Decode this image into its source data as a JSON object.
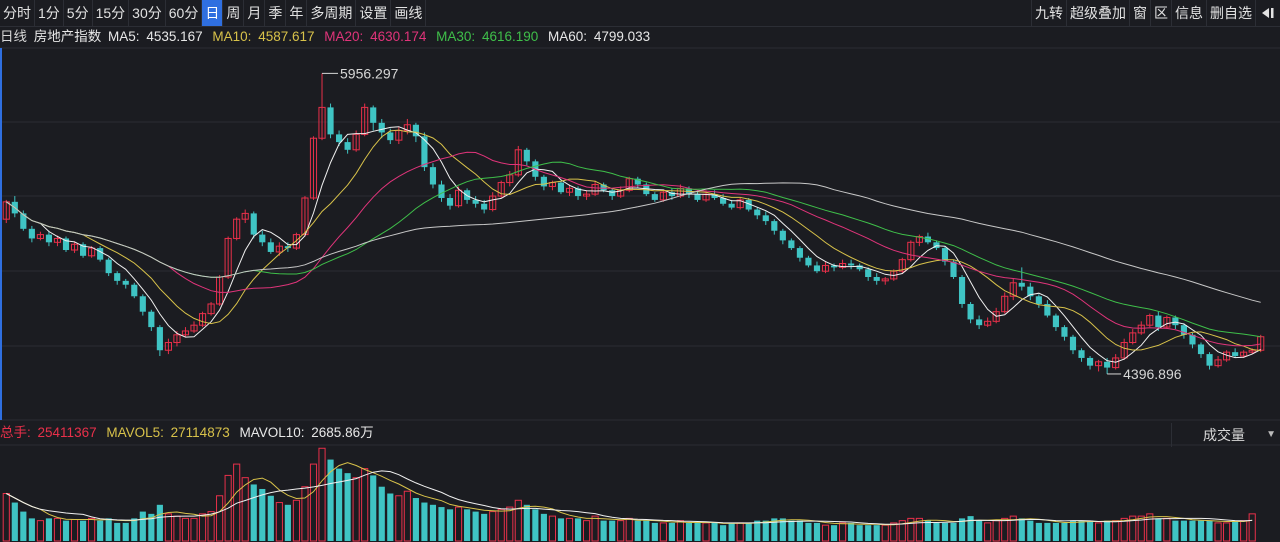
{
  "toolbar": {
    "periods": [
      "分时",
      "1分",
      "5分",
      "15分",
      "30分",
      "60分",
      "日",
      "周",
      "月",
      "季",
      "年",
      "多周期",
      "设置",
      "画线"
    ],
    "active_period": "日",
    "right_buttons": [
      "九转",
      "超级叠加",
      "窗",
      "区",
      "信息",
      "删自选"
    ],
    "exit_icon": "exit-arrow-icon"
  },
  "info": {
    "period": "日线",
    "name": "房地产指数",
    "ma5": {
      "label": "MA5:",
      "value": "4535.167",
      "color": "#e8e8e8"
    },
    "ma10": {
      "label": "MA10:",
      "value": "4587.617",
      "color": "#d8c24a"
    },
    "ma20": {
      "label": "MA20:",
      "value": "4630.174",
      "color": "#e0347a"
    },
    "ma30": {
      "label": "MA30:",
      "value": "4616.190",
      "color": "#3fbf4a"
    },
    "ma60": {
      "label": "MA60:",
      "value": "4799.033",
      "color": "#e8e8e8"
    }
  },
  "volume": {
    "total_label": "总手:",
    "total_value": "25411367",
    "mavol5_label": "MAVOL5:",
    "mavol5_value": "27114873",
    "mavol10_label": "MAVOL10:",
    "mavol10_value": "2685.86万",
    "selector": "成交量"
  },
  "chart_data": {
    "type": "candlestick",
    "high_label": "5956.297",
    "low_label": "4396.896",
    "high": 5956.297,
    "low": 4396.896,
    "colors": {
      "up": "#e8304a",
      "down": "#3fc4c4",
      "ma5": "#f0f0f0",
      "ma10": "#d8c24a",
      "ma20": "#e0347a",
      "ma30": "#3fbf4a",
      "ma60": "#c8c8c8"
    },
    "candles": [
      [
        5200,
        5290,
        5180,
        5300
      ],
      [
        5290,
        5230,
        5210,
        5320
      ],
      [
        5230,
        5150,
        5140,
        5245
      ],
      [
        5150,
        5100,
        5080,
        5165
      ],
      [
        5100,
        5120,
        5090,
        5135
      ],
      [
        5120,
        5080,
        5060,
        5140
      ],
      [
        5080,
        5100,
        5060,
        5115
      ],
      [
        5100,
        5040,
        5030,
        5110
      ],
      [
        5040,
        5070,
        5025,
        5085
      ],
      [
        5070,
        5010,
        5000,
        5080
      ],
      [
        5010,
        5050,
        5000,
        5060
      ],
      [
        5050,
        4990,
        4980,
        5060
      ],
      [
        4990,
        4920,
        4905,
        5000
      ],
      [
        4920,
        4880,
        4860,
        4930
      ],
      [
        4880,
        4860,
        4840,
        4890
      ],
      [
        4860,
        4800,
        4790,
        4870
      ],
      [
        4800,
        4720,
        4700,
        4810
      ],
      [
        4720,
        4640,
        4620,
        4730
      ],
      [
        4640,
        4520,
        4490,
        4650
      ],
      [
        4520,
        4560,
        4500,
        4580
      ],
      [
        4560,
        4600,
        4540,
        4620
      ],
      [
        4600,
        4620,
        4590,
        4640
      ],
      [
        4620,
        4650,
        4610,
        4670
      ],
      [
        4650,
        4710,
        4640,
        4720
      ],
      [
        4710,
        4760,
        4700,
        4770
      ],
      [
        4760,
        4900,
        4750,
        4910
      ],
      [
        4900,
        5100,
        4890,
        5110
      ],
      [
        5100,
        5200,
        5090,
        5210
      ],
      [
        5200,
        5230,
        5180,
        5250
      ],
      [
        5230,
        5120,
        5100,
        5240
      ],
      [
        5120,
        5080,
        5060,
        5140
      ],
      [
        5080,
        5030,
        5020,
        5100
      ],
      [
        5030,
        5060,
        5010,
        5080
      ],
      [
        5060,
        5050,
        5030,
        5080
      ],
      [
        5050,
        5120,
        5040,
        5130
      ],
      [
        5120,
        5310,
        5110,
        5320
      ],
      [
        5310,
        5620,
        5300,
        5630
      ],
      [
        5620,
        5780,
        5610,
        5956.3
      ],
      [
        5780,
        5640,
        5620,
        5800
      ],
      [
        5640,
        5600,
        5580,
        5660
      ],
      [
        5600,
        5560,
        5540,
        5620
      ],
      [
        5560,
        5640,
        5550,
        5660
      ],
      [
        5640,
        5780,
        5630,
        5800
      ],
      [
        5780,
        5700,
        5660,
        5790
      ],
      [
        5700,
        5650,
        5620,
        5720
      ],
      [
        5650,
        5610,
        5590,
        5670
      ],
      [
        5610,
        5660,
        5590,
        5680
      ],
      [
        5660,
        5690,
        5640,
        5720
      ],
      [
        5690,
        5630,
        5600,
        5700
      ],
      [
        5630,
        5470,
        5450,
        5650
      ],
      [
        5470,
        5380,
        5360,
        5490
      ],
      [
        5380,
        5310,
        5290,
        5400
      ],
      [
        5310,
        5270,
        5250,
        5330
      ],
      [
        5270,
        5350,
        5260,
        5370
      ],
      [
        5350,
        5300,
        5280,
        5360
      ],
      [
        5300,
        5280,
        5260,
        5320
      ],
      [
        5280,
        5250,
        5230,
        5300
      ],
      [
        5250,
        5320,
        5240,
        5340
      ],
      [
        5320,
        5390,
        5310,
        5400
      ],
      [
        5390,
        5430,
        5370,
        5450
      ],
      [
        5430,
        5560,
        5420,
        5580
      ],
      [
        5560,
        5500,
        5480,
        5570
      ],
      [
        5500,
        5420,
        5400,
        5510
      ],
      [
        5420,
        5370,
        5350,
        5430
      ],
      [
        5370,
        5390,
        5350,
        5400
      ],
      [
        5390,
        5340,
        5330,
        5400
      ],
      [
        5340,
        5360,
        5320,
        5380
      ],
      [
        5360,
        5320,
        5300,
        5370
      ],
      [
        5320,
        5330,
        5300,
        5350
      ],
      [
        5330,
        5380,
        5320,
        5400
      ],
      [
        5380,
        5350,
        5340,
        5390
      ],
      [
        5350,
        5320,
        5300,
        5360
      ],
      [
        5320,
        5350,
        5310,
        5370
      ],
      [
        5350,
        5410,
        5340,
        5420
      ],
      [
        5410,
        5380,
        5360,
        5420
      ],
      [
        5380,
        5330,
        5320,
        5390
      ],
      [
        5330,
        5300,
        5290,
        5340
      ],
      [
        5300,
        5340,
        5290,
        5350
      ],
      [
        5340,
        5320,
        5300,
        5360
      ],
      [
        5320,
        5360,
        5310,
        5380
      ],
      [
        5360,
        5330,
        5310,
        5370
      ],
      [
        5330,
        5300,
        5290,
        5350
      ],
      [
        5300,
        5330,
        5290,
        5350
      ],
      [
        5330,
        5310,
        5300,
        5350
      ],
      [
        5310,
        5280,
        5270,
        5330
      ],
      [
        5280,
        5260,
        5250,
        5300
      ],
      [
        5260,
        5300,
        5250,
        5310
      ],
      [
        5300,
        5250,
        5240,
        5310
      ],
      [
        5250,
        5220,
        5200,
        5260
      ],
      [
        5220,
        5190,
        5170,
        5240
      ],
      [
        5190,
        5140,
        5120,
        5200
      ],
      [
        5140,
        5090,
        5070,
        5150
      ],
      [
        5090,
        5050,
        5040,
        5100
      ],
      [
        5050,
        5000,
        4980,
        5060
      ],
      [
        5000,
        4960,
        4950,
        5010
      ],
      [
        4960,
        4930,
        4920,
        4980
      ],
      [
        4930,
        4960,
        4920,
        4980
      ],
      [
        4960,
        4950,
        4930,
        4970
      ],
      [
        4950,
        4970,
        4940,
        4990
      ],
      [
        4970,
        4960,
        4940,
        4990
      ],
      [
        4960,
        4940,
        4930,
        4970
      ],
      [
        4940,
        4900,
        4880,
        4950
      ],
      [
        4900,
        4880,
        4860,
        4920
      ],
      [
        4880,
        4890,
        4860,
        4900
      ],
      [
        4890,
        4930,
        4880,
        4940
      ],
      [
        4930,
        4990,
        4920,
        5000
      ],
      [
        4990,
        5080,
        4980,
        5090
      ],
      [
        5080,
        5110,
        5060,
        5120
      ],
      [
        5110,
        5080,
        5070,
        5130
      ],
      [
        5080,
        5050,
        5040,
        5090
      ],
      [
        5050,
        4980,
        4960,
        5060
      ],
      [
        4980,
        4900,
        4890,
        4990
      ],
      [
        4900,
        4760,
        4740,
        4910
      ],
      [
        4760,
        4680,
        4660,
        4770
      ],
      [
        4680,
        4650,
        4630,
        4700
      ],
      [
        4650,
        4670,
        4640,
        4690
      ],
      [
        4670,
        4720,
        4660,
        4740
      ],
      [
        4720,
        4800,
        4710,
        4820
      ],
      [
        4800,
        4870,
        4780,
        4890
      ],
      [
        4870,
        4850,
        4830,
        4950
      ],
      [
        4850,
        4800,
        4780,
        4870
      ],
      [
        4800,
        4760,
        4740,
        4810
      ],
      [
        4760,
        4700,
        4690,
        4780
      ],
      [
        4700,
        4640,
        4620,
        4710
      ],
      [
        4640,
        4590,
        4570,
        4650
      ],
      [
        4590,
        4520,
        4500,
        4600
      ],
      [
        4520,
        4480,
        4460,
        4530
      ],
      [
        4480,
        4440,
        4420,
        4490
      ],
      [
        4440,
        4460,
        4410,
        4470
      ],
      [
        4460,
        4430,
        4396.9,
        4480
      ],
      [
        4430,
        4480,
        4420,
        4500
      ],
      [
        4480,
        4560,
        4470,
        4580
      ],
      [
        4560,
        4610,
        4550,
        4630
      ],
      [
        4610,
        4650,
        4600,
        4670
      ],
      [
        4650,
        4700,
        4640,
        4710
      ],
      [
        4700,
        4640,
        4620,
        4720
      ],
      [
        4640,
        4690,
        4630,
        4700
      ],
      [
        4690,
        4650,
        4630,
        4700
      ],
      [
        4650,
        4600,
        4580,
        4660
      ],
      [
        4600,
        4550,
        4530,
        4610
      ],
      [
        4550,
        4500,
        4480,
        4560
      ],
      [
        4500,
        4440,
        4420,
        4510
      ],
      [
        4440,
        4470,
        4430,
        4490
      ],
      [
        4470,
        4510,
        4460,
        4520
      ],
      [
        4510,
        4490,
        4480,
        4530
      ],
      [
        4490,
        4510,
        4480,
        4520
      ],
      [
        4510,
        4520,
        4500,
        4530
      ],
      [
        4520,
        4590,
        4510,
        4600
      ]
    ],
    "volumes": [
      2.1,
      1.7,
      1.3,
      1.0,
      0.9,
      1.0,
      1.0,
      0.9,
      0.95,
      0.9,
      1.0,
      0.9,
      1.0,
      0.8,
      0.8,
      1.0,
      1.3,
      1.2,
      1.6,
      1.2,
      1.1,
      1.0,
      1.0,
      1.2,
      1.3,
      2.0,
      2.9,
      3.4,
      2.8,
      2.5,
      2.3,
      2.0,
      1.7,
      1.6,
      1.8,
      2.4,
      3.4,
      4.1,
      3.6,
      3.2,
      3.0,
      2.8,
      3.2,
      2.9,
      2.4,
      2.1,
      2.0,
      2.2,
      1.9,
      1.7,
      1.6,
      1.5,
      1.4,
      1.5,
      1.4,
      1.3,
      1.2,
      1.3,
      1.4,
      1.5,
      1.8,
      1.6,
      1.4,
      1.2,
      1.1,
      1.0,
      1.0,
      1.0,
      0.9,
      1.1,
      0.9,
      0.9,
      0.9,
      1.0,
      0.9,
      0.9,
      0.8,
      0.8,
      0.8,
      0.9,
      0.8,
      0.8,
      0.8,
      0.8,
      0.7,
      0.8,
      0.8,
      0.8,
      0.9,
      0.9,
      1.0,
      1.0,
      0.9,
      0.9,
      0.8,
      0.8,
      0.7,
      0.7,
      0.8,
      0.8,
      0.7,
      0.7,
      0.7,
      0.7,
      0.8,
      0.9,
      1.0,
      1.0,
      0.9,
      0.8,
      0.8,
      0.8,
      1.0,
      1.1,
      0.9,
      0.8,
      0.9,
      1.0,
      1.1,
      1.0,
      0.9,
      0.8,
      0.8,
      0.8,
      0.8,
      0.9,
      0.9,
      0.9,
      0.8,
      0.9,
      0.9,
      1.0,
      1.1,
      1.1,
      1.2,
      1.0,
      1.0,
      0.9,
      0.9,
      0.9,
      0.9,
      0.9,
      0.8,
      0.8,
      0.9,
      0.9,
      1.2
    ]
  }
}
